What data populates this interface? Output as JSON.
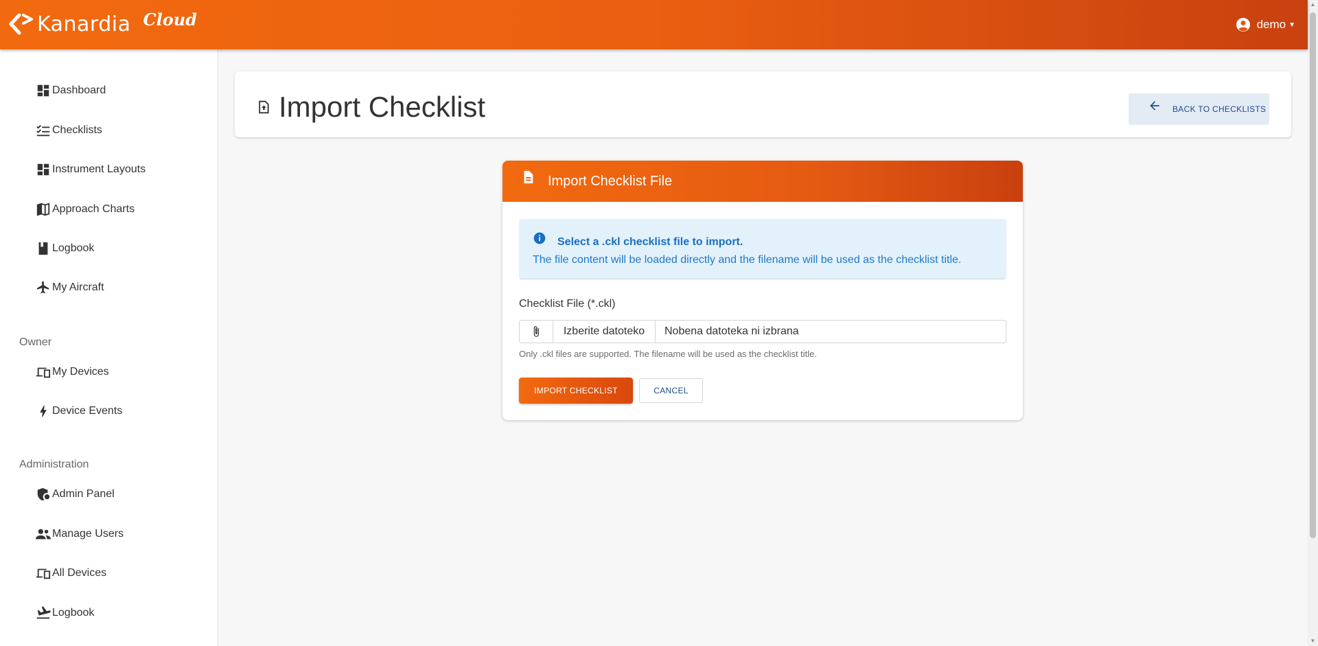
{
  "brand": {
    "name": "Kanardia",
    "suffix": "Cloud",
    "logo_icon": "kanardia-arrow-logo"
  },
  "user": {
    "name": "demo",
    "icon": "account-circle-icon"
  },
  "sidebar": {
    "items": [
      {
        "label": "Dashboard",
        "icon": "dashboard-icon"
      },
      {
        "label": "Checklists",
        "icon": "checklist-icon"
      },
      {
        "label": "Instrument Layouts",
        "icon": "grid-layout-icon"
      },
      {
        "label": "Approach Charts",
        "icon": "map-icon"
      },
      {
        "label": "Logbook",
        "icon": "book-icon"
      },
      {
        "label": "My Aircraft",
        "icon": "airplane-icon"
      }
    ],
    "owner_section": "Owner",
    "owner_items": [
      {
        "label": "My Devices",
        "icon": "devices-icon"
      },
      {
        "label": "Device Events",
        "icon": "bolt-icon"
      }
    ],
    "admin_section": "Administration",
    "admin_items": [
      {
        "label": "Admin Panel",
        "icon": "admin-shield-icon"
      },
      {
        "label": "Manage Users",
        "icon": "users-icon"
      },
      {
        "label": "All Devices",
        "icon": "devices-icon"
      },
      {
        "label": "Logbook",
        "icon": "flight-land-icon"
      }
    ]
  },
  "header": {
    "title": "Import Checklist",
    "title_icon": "file-upload-icon",
    "back_button": "BACK TO CHECKLISTS"
  },
  "card": {
    "title": "Import Checklist File",
    "title_icon": "document-icon",
    "info_title": "Select a .ckl checklist file to import.",
    "info_text": "The file content will be loaded directly and the filename will be used as the checklist title.",
    "file_label": "Checklist File (*.ckl)",
    "choose_button": "Izberite datoteko",
    "file_status": "Nobena datoteka ni izbrana",
    "help_text": "Only .ckl files are supported. The filename will be used as the checklist title.",
    "import_button": "IMPORT CHECKLIST",
    "cancel_button": "CANCEL"
  },
  "colors": {
    "accent": "#f26a0f",
    "accent_dark": "#c8410f",
    "info_bg": "#e3f1fb",
    "info_text": "#1f78c8",
    "link": "#1f4a8a"
  }
}
